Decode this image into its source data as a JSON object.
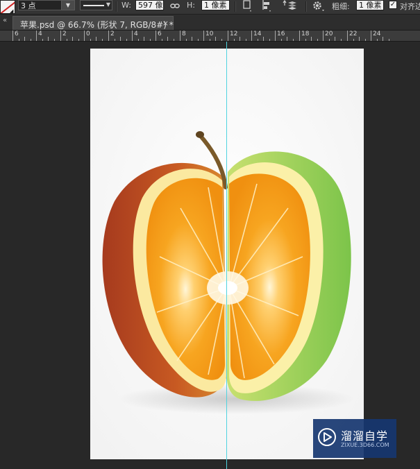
{
  "options_bar": {
    "stroke_size": "3 点",
    "width_label": "W:",
    "width_value": "597 像素",
    "height_label": "H:",
    "height_value": "1 像素",
    "weight_label": "粗细:",
    "weight_value": "1 像素",
    "align_edges_label": "对齐边缘",
    "align_edges_checked": true
  },
  "document_tab": {
    "title": "苹果.psd @ 66.7% (形状 7, RGB/8#) *",
    "close": "×",
    "collapse": "«"
  },
  "ruler": {
    "labels": [
      "6",
      "4",
      "2",
      "0",
      "2",
      "4",
      "6",
      "8",
      "10",
      "12",
      "14",
      "16",
      "18",
      "20",
      "22",
      "24"
    ]
  },
  "canvas": {
    "background": "#fbfbfb",
    "guide_color": "#4fd3e0"
  },
  "watermark": {
    "title": "溜溜自学",
    "site": "ZIXUE.3D66.COM",
    "background": "#163670"
  }
}
